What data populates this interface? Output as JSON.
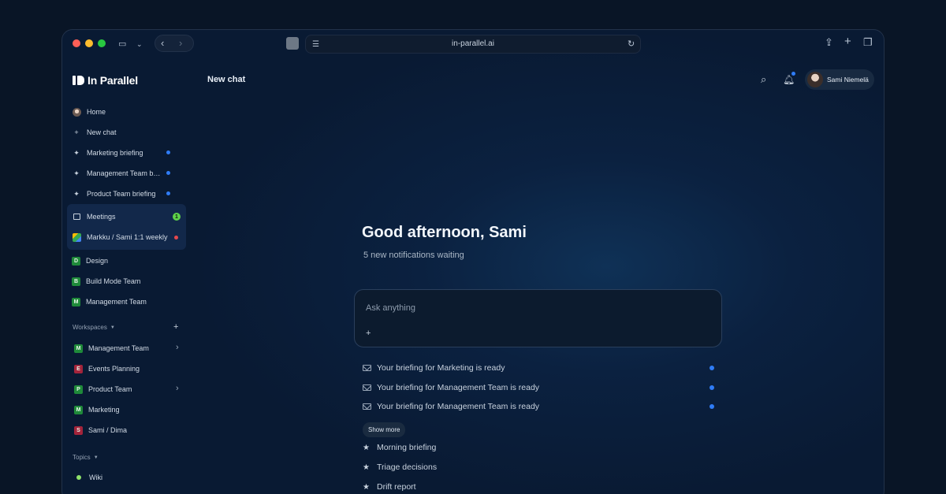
{
  "browser": {
    "url": "in-parallel.ai",
    "traffic_lights": {
      "close": "#ff5f57",
      "minimize": "#febc2e",
      "zoom": "#28c840"
    }
  },
  "app": {
    "logo_text": "In Parallel",
    "page_title": "New chat"
  },
  "header": {
    "user_name": "Sami Niemelä"
  },
  "sidebar": {
    "top_items": [
      {
        "label": "Home",
        "icon": "home-avatar-icon"
      },
      {
        "label": "New chat",
        "icon": "plus-icon"
      },
      {
        "label": "Marketing briefing",
        "icon": "sparkle-icon",
        "dot_color": "#2f7cf6"
      },
      {
        "label": "Management Team b…",
        "icon": "sparkle-icon",
        "dot_color": "#2f7cf6"
      },
      {
        "label": "Product Team briefing",
        "icon": "sparkle-icon",
        "dot_color": "#2f7cf6"
      }
    ],
    "meetings": {
      "label": "Meetings",
      "count": "1"
    },
    "meeting_item": {
      "label": "Markku / Sami 1:1 weekly",
      "dot_color": "#e5484d"
    },
    "teams": [
      {
        "letter": "D",
        "label": "Design",
        "color": "#1f8a3a"
      },
      {
        "letter": "B",
        "label": "Build Mode Team",
        "color": "#1f8a3a"
      },
      {
        "letter": "M",
        "label": "Management Team",
        "color": "#1f8a3a"
      }
    ],
    "workspaces_label": "Workspaces",
    "workspaces": [
      {
        "letter": "M",
        "label": "Management Team",
        "color": "#1f8a3a",
        "chevron": true
      },
      {
        "letter": "E",
        "label": "Events Planning",
        "color": "#a3243b",
        "chevron": false
      },
      {
        "letter": "P",
        "label": "Product Team",
        "color": "#1f8a3a",
        "chevron": true
      },
      {
        "letter": "M",
        "label": "Marketing",
        "color": "#1f8a3a",
        "chevron": false
      },
      {
        "letter": "S",
        "label": "Sami / Dima",
        "color": "#a3243b",
        "chevron": false
      }
    ],
    "topics_label": "Topics",
    "topics": [
      {
        "label": "Wiki",
        "dot_color": "#8fe36a"
      }
    ]
  },
  "main": {
    "greeting": "Good afternoon, Sami",
    "subtitle": "5 new notifications waiting",
    "chat_placeholder": "Ask anything",
    "notifications": [
      "Your briefing for Marketing is ready",
      "Your briefing for Management Team is ready",
      "Your briefing for Management Team is ready"
    ],
    "show_more": "Show more",
    "starred": [
      "Morning briefing",
      "Triage decisions",
      "Drift report"
    ]
  }
}
